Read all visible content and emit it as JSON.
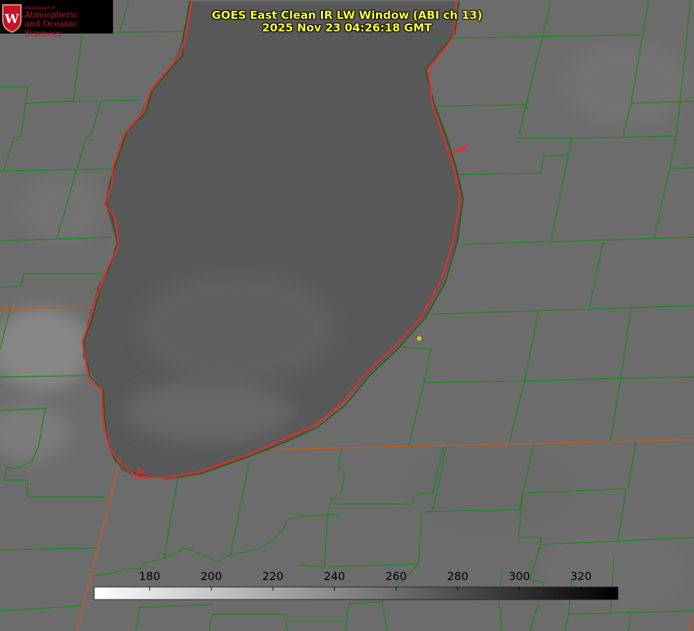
{
  "title": {
    "line1": "GOES East Clean IR LW Window (ABI ch 13)",
    "line2": "2025 Nov 23 04:26:18 GMT"
  },
  "logo": {
    "dept": "Department of",
    "line1": "Atmospheric",
    "line2": "and Oceanic Sciences",
    "crest_letter": "W"
  },
  "colorbar": {
    "ticks": [
      "180",
      "200",
      "220",
      "240",
      "260",
      "280",
      "300",
      "320"
    ],
    "tick_values": [
      180,
      200,
      220,
      240,
      260,
      280,
      300,
      320
    ],
    "range": [
      162,
      332
    ],
    "color_low": "#ffffff",
    "color_high": "#000000"
  },
  "colors": {
    "county_lines": "#1a8a1a",
    "state_lines": "#c85a1a",
    "coastline_red": "#ff2222",
    "title_text": "#ffff33",
    "station_dot": "#d8c81a"
  }
}
